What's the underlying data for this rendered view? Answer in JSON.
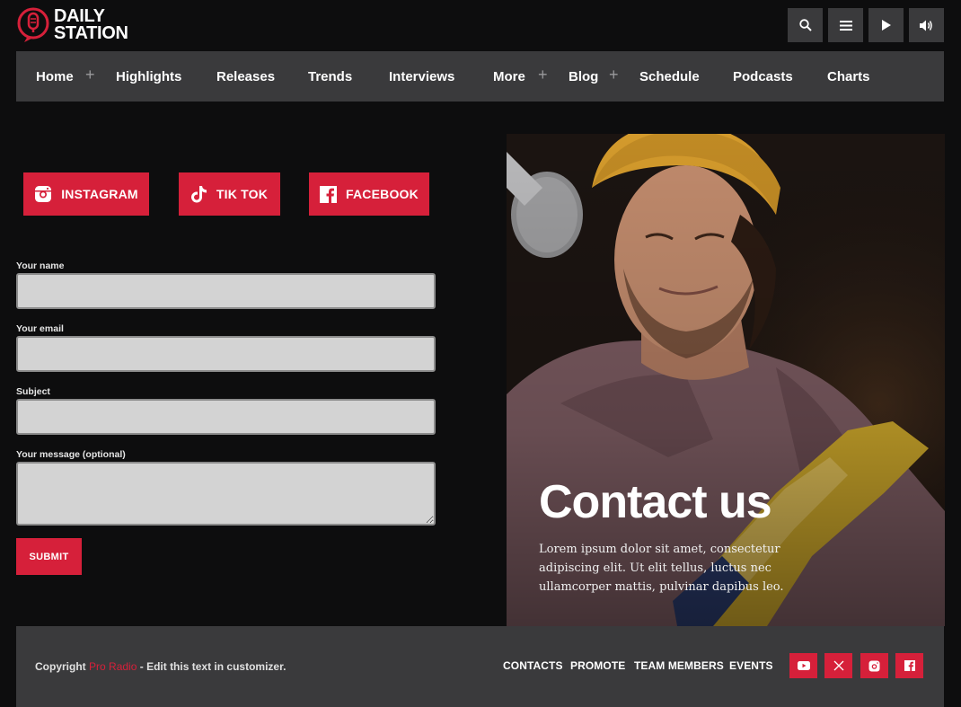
{
  "brand": {
    "line1": "DAILY",
    "line2": "STATION",
    "accent": "#d6203a"
  },
  "header_icons": [
    {
      "icon": "search-icon"
    },
    {
      "icon": "menu-icon"
    },
    {
      "icon": "play-icon"
    },
    {
      "icon": "volume-icon"
    }
  ],
  "nav": {
    "items": [
      {
        "label": "Home",
        "has_submenu": true
      },
      {
        "label": "Highlights",
        "has_submenu": false
      },
      {
        "label": "Releases",
        "has_submenu": false
      },
      {
        "label": "Trends",
        "has_submenu": false
      },
      {
        "label": "Interviews",
        "has_submenu": false
      },
      {
        "label": "More",
        "has_submenu": true
      },
      {
        "label": "Blog",
        "has_submenu": true
      },
      {
        "label": "Schedule",
        "has_submenu": false
      },
      {
        "label": "Podcasts",
        "has_submenu": false
      },
      {
        "label": "Charts",
        "has_submenu": false
      }
    ],
    "plus": "+"
  },
  "social": {
    "instagram": "INSTAGRAM",
    "tiktok": "TIK TOK",
    "facebook": "FACEBOOK"
  },
  "form": {
    "name_label": "Your name",
    "name_value": "",
    "email_label": "Your email",
    "email_value": "",
    "subject_label": "Subject",
    "subject_value": "",
    "message_label": "Your message (optional)",
    "message_value": "",
    "submit_label": "SUBMIT"
  },
  "hero": {
    "title": "Contact us",
    "text": "Lorem ipsum dolor sit amet, consectetur adipiscing elit. Ut elit tellus, luctus nec ullamcorper mattis, pulvinar dapibus leo."
  },
  "footer": {
    "copyright_prefix": "Copyright",
    "copyright_brand": "Pro Radio",
    "copyright_suffix": "- Edit this text in customizer.",
    "links": [
      "CONTACTS",
      "PROMOTE",
      "TEAM MEMBERS",
      "EVENTS"
    ],
    "social_icons": [
      "youtube-icon",
      "x-icon",
      "instagram-icon",
      "facebook-icon"
    ]
  }
}
